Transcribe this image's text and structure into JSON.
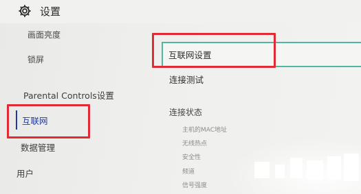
{
  "header": {
    "title": "设置",
    "icon": "gear-icon"
  },
  "sidebar": {
    "items": [
      {
        "label": "画面亮度"
      },
      {
        "label": "锁屏"
      },
      {
        "label": "Parental Controls设置"
      },
      {
        "label": "互联网",
        "selected": true
      },
      {
        "label": "数据管理"
      },
      {
        "label": "用户"
      }
    ]
  },
  "main": {
    "internet_settings": "互联网设置",
    "connection_test": "连接测试",
    "connection_status": {
      "title": "连接状态",
      "fields": [
        "主机的MAC地址",
        "无线热点",
        "安全性",
        "频道",
        "信号强度"
      ]
    }
  },
  "colors": {
    "highlight_box": "#e12a35",
    "selection_accent": "#1f3a9e",
    "focus_border": "#4fb79e"
  }
}
